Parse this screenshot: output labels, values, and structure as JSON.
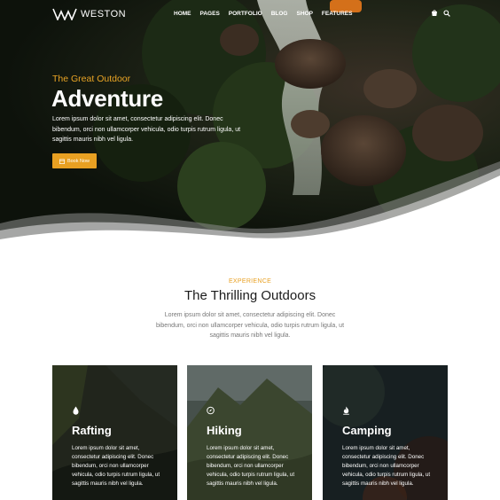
{
  "brand": {
    "name": "WESTON"
  },
  "nav": {
    "items": [
      "HOME",
      "PAGES",
      "PORTFOLIO",
      "BLOG",
      "SHOP",
      "FEATURES"
    ],
    "icons": [
      "cart-icon",
      "search-icon"
    ]
  },
  "hero": {
    "subtitle": "The Great Outdoor",
    "title": "Adventure",
    "text": "Lorem ipsum dolor sit amet, consectetur adipiscing elit. Donec bibendum, orci non ullamcorper vehicula, odio turpis rutrum ligula, ut sagittis mauris nibh vel ligula.",
    "button_label": "Book Now",
    "button_icon": "calendar-icon"
  },
  "section": {
    "eyebrow": "EXPERIENCE",
    "title": "The Thrilling Outdoors",
    "text": "Lorem ipsum dolor sit amet, consectetur adipiscing elit. Donec bibendum, orci non ullamcorper vehicula, odio turpis rutrum ligula, ut sagittis mauris nibh vel ligula."
  },
  "cards": [
    {
      "title": "Rafting",
      "icon": "water-drop-icon",
      "text": "Lorem ipsum dolor sit amet, consectetur adipiscing elit. Donec bibendum, orci non ullamcorper vehicula, odio turpis rutrum ligula, ut sagittis mauris nibh vel ligula."
    },
    {
      "title": "Hiking",
      "icon": "compass-icon",
      "text": "Lorem ipsum dolor sit amet, consectetur adipiscing elit. Donec bibendum, orci non ullamcorper vehicula, odio turpis rutrum ligula, ut sagittis mauris nibh vel ligula."
    },
    {
      "title": "Camping",
      "icon": "flame-icon",
      "text": "Lorem ipsum dolor sit amet, consectetur adipiscing elit. Donec bibendum, orci non ullamcorper vehicula, odio turpis rutrum ligula, ut sagittis mauris nibh vel ligula."
    }
  ],
  "colors": {
    "accent": "#e8a022",
    "heading": "#1b1b1b",
    "body_text": "#777777"
  }
}
